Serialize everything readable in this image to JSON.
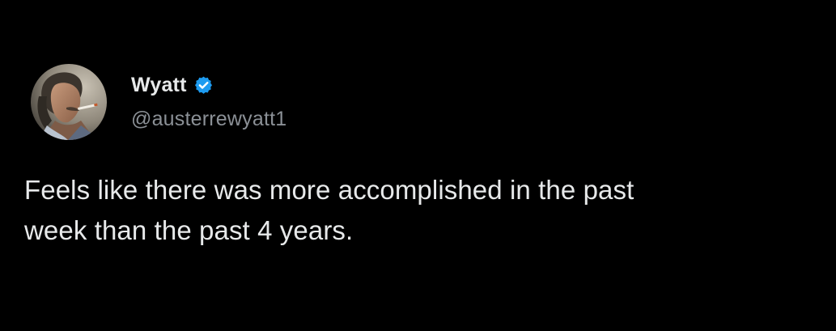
{
  "tweet": {
    "author": {
      "display_name": "Wyatt",
      "handle": "@austerrewyatt1",
      "verified": true,
      "verified_icon": "verified-badge-icon",
      "verified_color": "#1d9bf0"
    },
    "text": "Feels like there was more accomplished in the past\nweek than the past 4 years."
  },
  "theme": {
    "background": "#000000",
    "text_primary": "#e7e9ea",
    "text_secondary": "#8b9096"
  }
}
